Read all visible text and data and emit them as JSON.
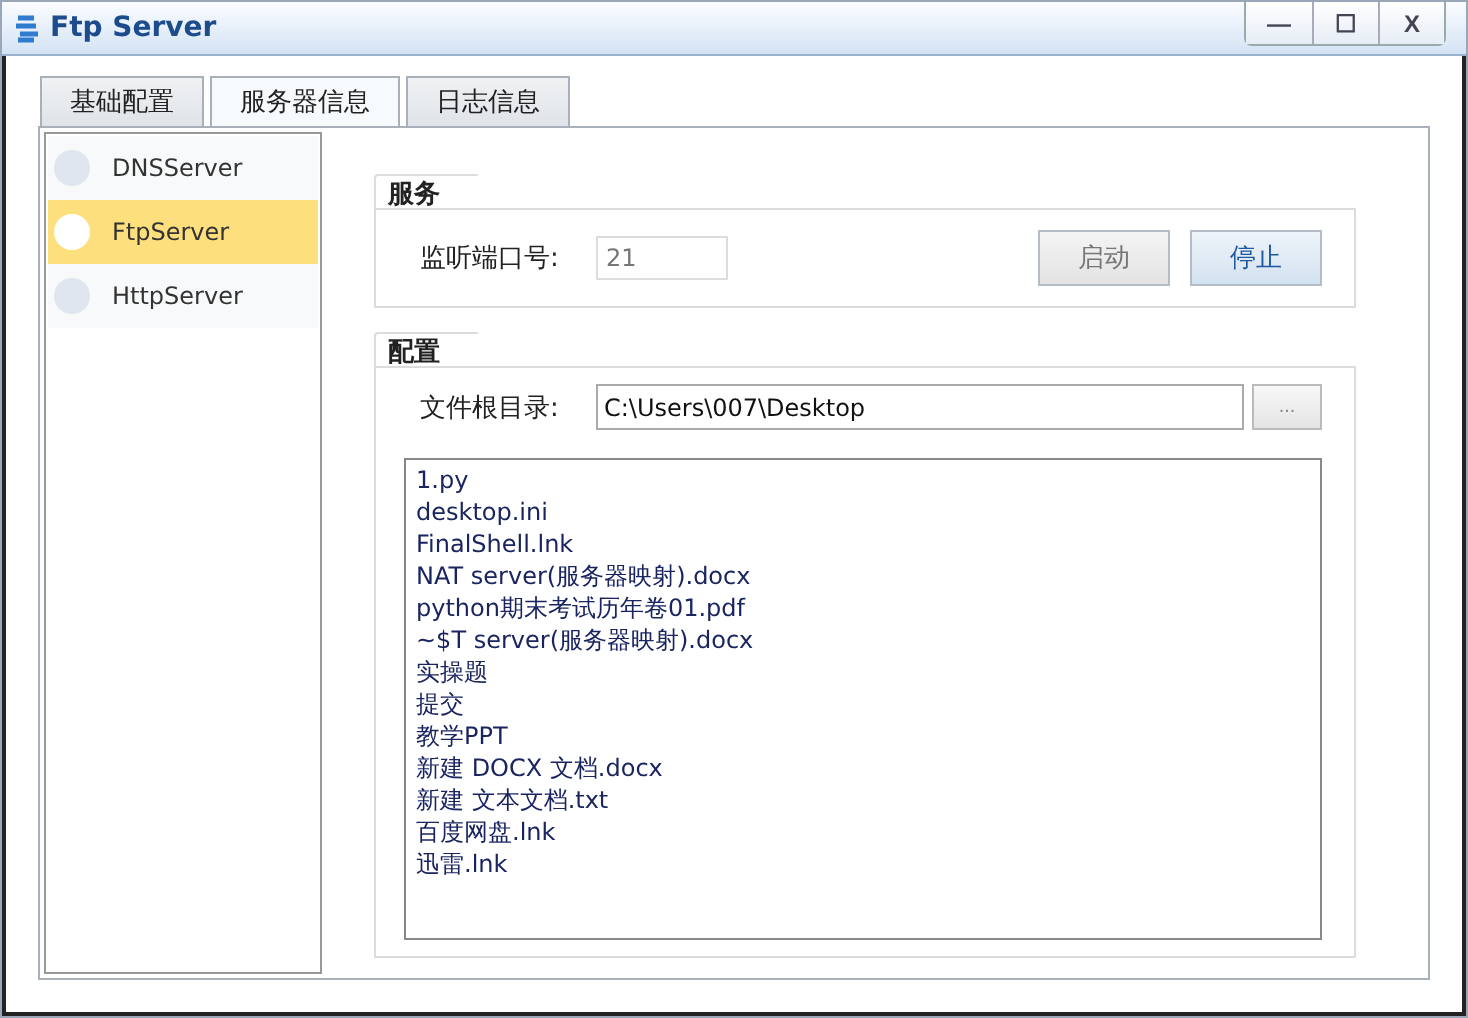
{
  "window": {
    "title": "Ftp Server",
    "controls": [
      "—",
      "☐",
      "X"
    ]
  },
  "tabs": [
    {
      "label": "基础配置",
      "selected": false
    },
    {
      "label": "服务器信息",
      "selected": true
    },
    {
      "label": "日志信息",
      "selected": false
    }
  ],
  "sidebar": {
    "items": [
      {
        "label": "DNSServer",
        "selected": false
      },
      {
        "label": "FtpServer",
        "selected": true
      },
      {
        "label": "HttpServer",
        "selected": false
      }
    ]
  },
  "service": {
    "title": "服务",
    "port_label": "监听端口号:",
    "port_value": "21",
    "buttons": [
      {
        "label": "启动",
        "disabled": true
      },
      {
        "label": "停止",
        "disabled": false
      }
    ]
  },
  "config": {
    "title": "配置",
    "root_label": "文件根目录:",
    "root_value": "C:\\Users\\007\\Desktop",
    "browse_button": "...",
    "files": [
      "1.py",
      "desktop.ini",
      "FinalShell.lnk",
      "NAT server(服务器映射).docx",
      "python期末考试历年卷01.pdf",
      "~$T server(服务器映射).docx",
      "实操题",
      "提交",
      "教学PPT",
      "新建 DOCX 文档.docx",
      "新建 文本文档.txt",
      "百度网盘.lnk",
      "迅雷.lnk"
    ]
  }
}
